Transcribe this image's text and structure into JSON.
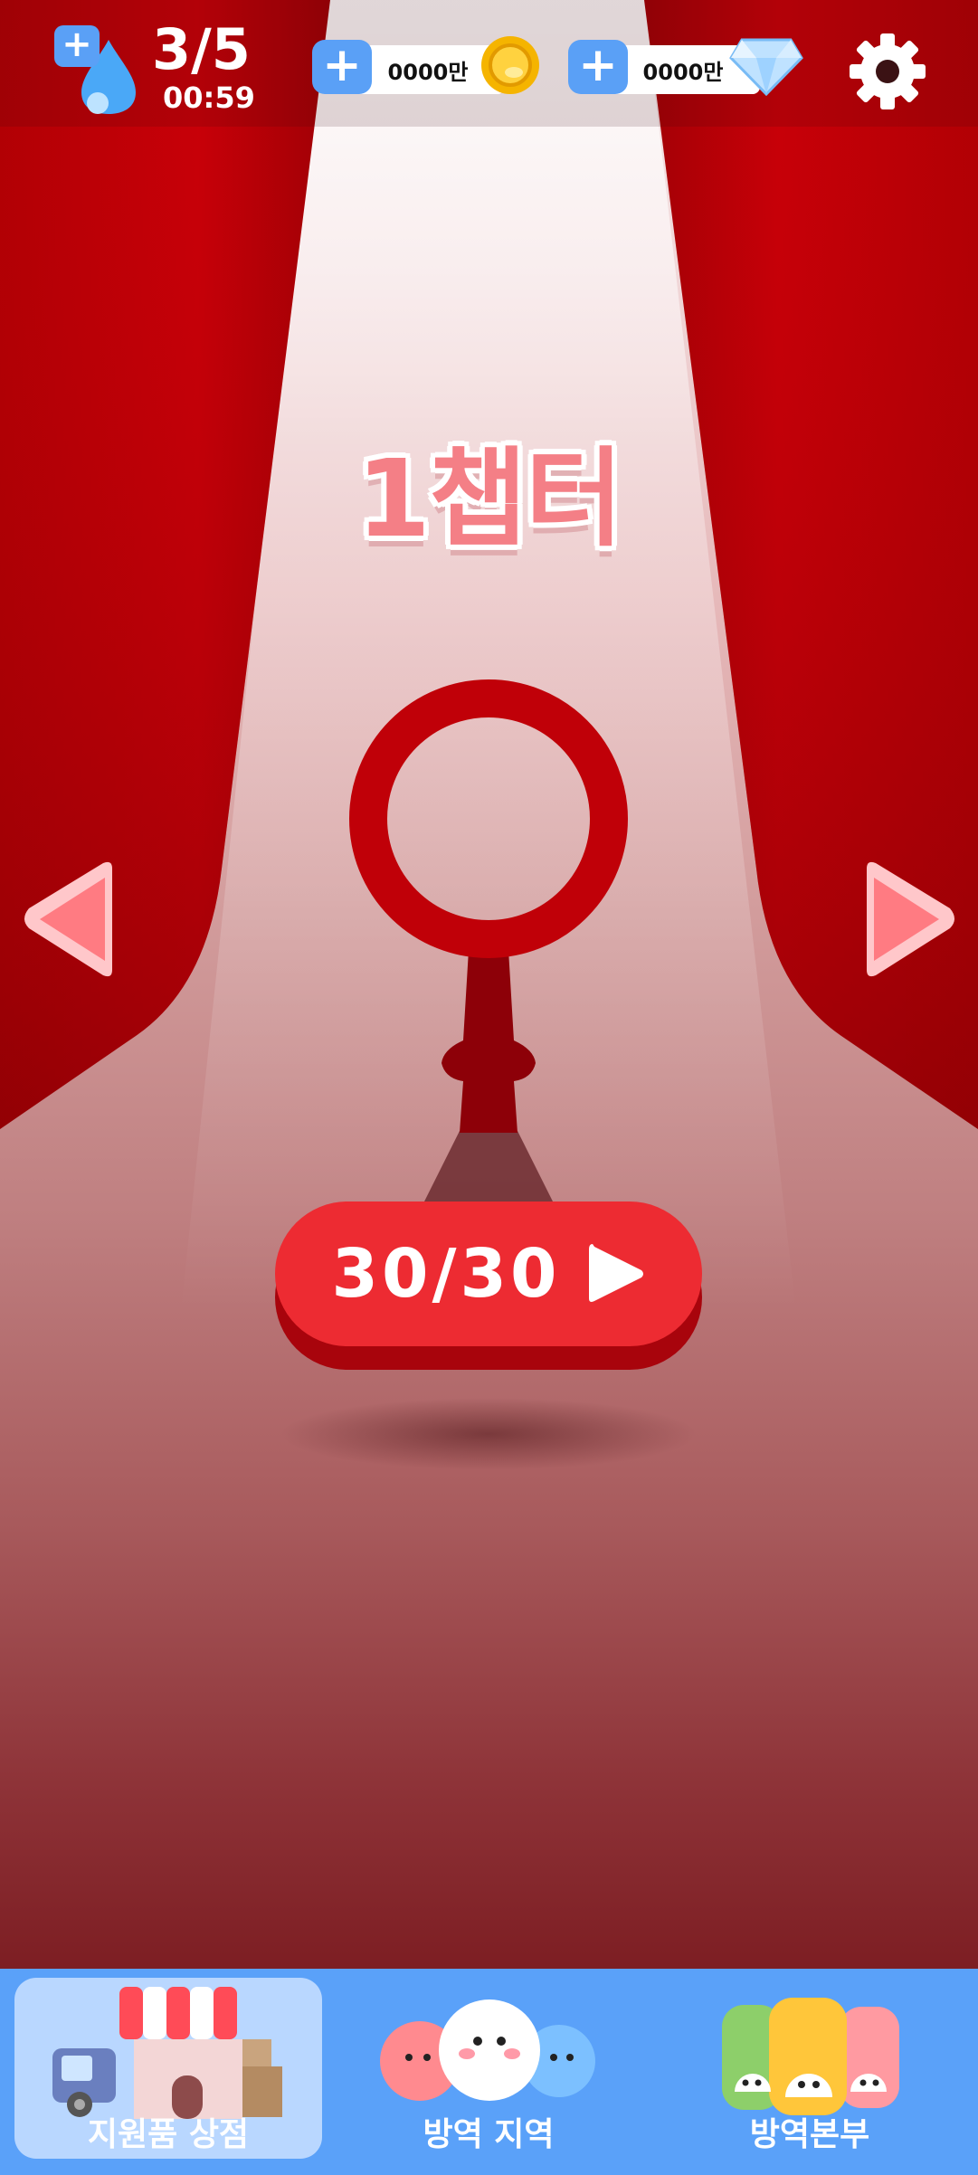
{
  "hud": {
    "energy": {
      "value": "3/5",
      "timer": "00:59",
      "icon": "water-drop-icon"
    },
    "coins": {
      "amount": "0000만",
      "icon": "coin-icon"
    },
    "gems": {
      "amount": "0000만",
      "icon": "diamond-icon"
    },
    "settings_icon": "gear-icon"
  },
  "stage": {
    "chapter_title": "1챕터",
    "progress_label": "30/30",
    "play_icon": "play-icon",
    "prev_icon": "arrow-left-icon",
    "next_icon": "arrow-right-icon"
  },
  "bottom_nav": {
    "items": [
      {
        "label": "지원품 상점",
        "icon": "shop-icon",
        "selected": true
      },
      {
        "label": "방역 지역",
        "icon": "virus-characters-icon",
        "selected": false
      },
      {
        "label": "방역본부",
        "icon": "hq-characters-icon",
        "selected": false
      }
    ]
  },
  "colors": {
    "curtain": "#c20006",
    "accent_red": "#ed2b32",
    "nav_blue": "#5aa1f9",
    "nav_selected": "#b9d7ff",
    "title_pink": "#f47f86",
    "arrow_pink": "#ff7b82"
  }
}
